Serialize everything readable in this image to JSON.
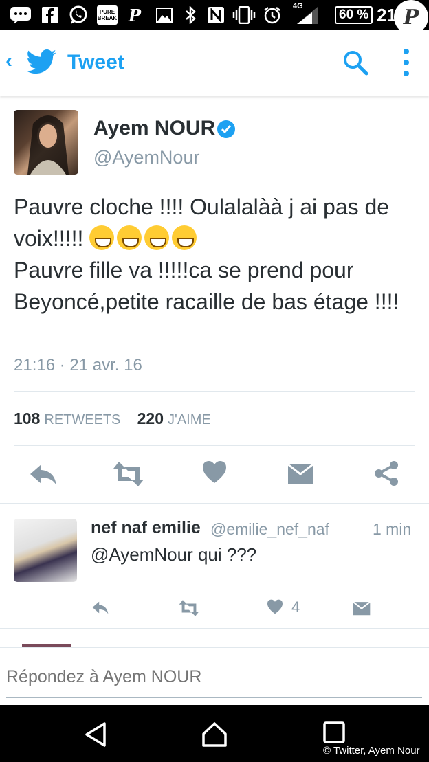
{
  "status_bar": {
    "network": "4G",
    "battery": "60 %",
    "time": "21",
    "notification_icons": [
      "message-icon",
      "facebook-icon",
      "whatsapp-icon",
      "purebreak-icon",
      "p-icon",
      "image-icon",
      "bluetooth-icon",
      "nfc-icon",
      "vibrate-icon",
      "alarm-icon",
      "signal-icon"
    ],
    "purebreak_label": "PURE BREAK",
    "watermark": "P"
  },
  "app_bar": {
    "title": "Tweet",
    "accent": "#1da1f2"
  },
  "tweet": {
    "author_name": "Ayem NOUR",
    "author_handle": "@AyemNour",
    "line1": "Pauvre cloche !!!! Oulalalàà j ai pas de voix!!!!!",
    "emoji_count": 4,
    "line2": "Pauvre fille va !!!!!ca se prend pour Beyoncé,petite racaille de bas étage !!!!",
    "timestamp": "21:16 · 21 avr. 16",
    "retweets_count": "108",
    "retweets_label": "RETWEETS",
    "likes_count": "220",
    "likes_label": "J'AIME"
  },
  "reply": {
    "author_name": "nef naf emilie",
    "author_handle": "@emilie_nef_naf",
    "time": "1 min",
    "text": "@AyemNour qui ???",
    "like_count": "4"
  },
  "composer": {
    "placeholder": "Répondez à Ayem NOUR"
  },
  "credit": "© Twitter, Ayem Nour",
  "colors": {
    "twitter_blue": "#1da1f2",
    "icon_gray": "#8899a6",
    "text_dark": "#292f33"
  }
}
